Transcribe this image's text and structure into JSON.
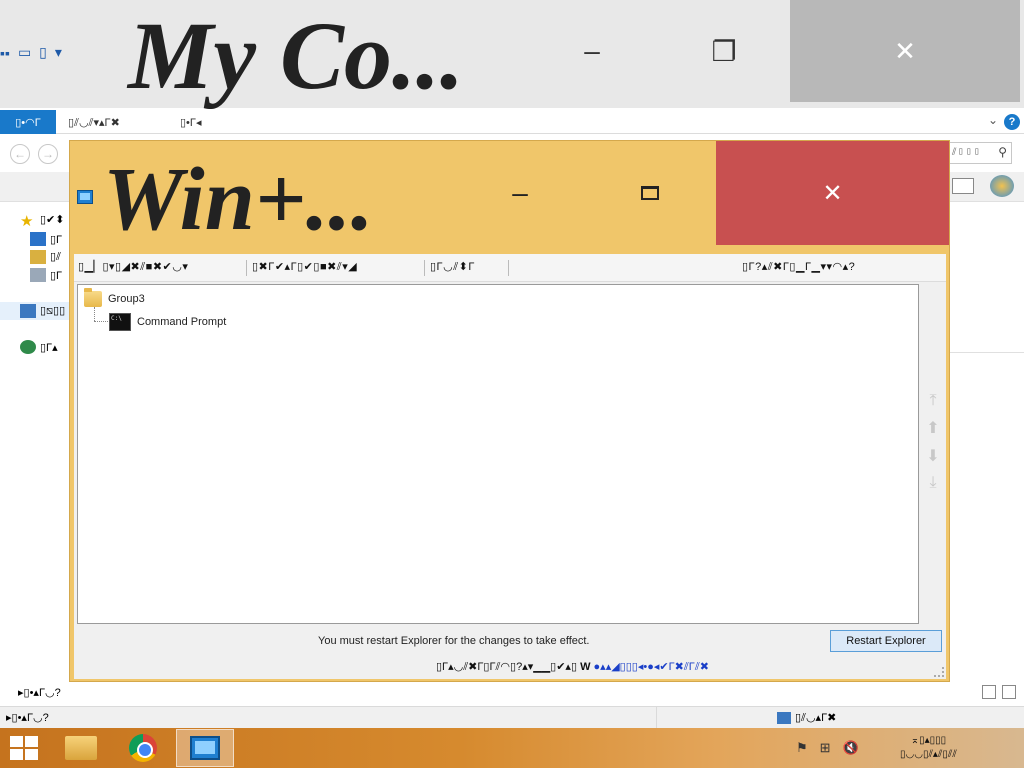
{
  "background_window": {
    "title": "My Co...",
    "ribbon": {
      "file_tab": "▯•◠Γ",
      "tabs": [
        "▯⫽◡⫽▾▴Γ✖",
        "▯•Γ◂"
      ]
    },
    "search_placeholder": "⫽▯▯▯",
    "nav_items": [
      "▯✔⬍",
      "▯Γ",
      "▯⫽",
      "▯Γ",
      "▯⧅▯▯",
      "▯Γ▴"
    ],
    "status_left": "▸▯•▴Γ◡?",
    "status2_left": "▸▯•▴Γ◡?",
    "status2_right": "▯⫽◡▴Γ✖"
  },
  "window": {
    "title": "Win+...",
    "toolbar": {
      "group1": "▯▁▏▯▾▯◢✖⫽■✖✔◡▾",
      "group2": "▯✖Γ✔▴Γ▯✔▯■✖⫽▾◢",
      "group3": "▯Γ◡⫽⬍Γ",
      "group4": "▯Γ?▴⫽✖Γ▯▁Γ▁▾▾◠▴?"
    },
    "tree": {
      "group": "Group3",
      "items": [
        "Command Prompt"
      ]
    },
    "notice": "You must restart Explorer for the changes to take effect.",
    "restart_button": "Restart Explorer",
    "footer_text": "▯Γ▴◡⫽✖Γ▯Γ⫽◠▯?▴▾▁▁▯✔▴▯",
    "footer_logo": "W",
    "footer_text2": "●▴▴◢▯▯▯◂•●◂✔Γ✖⫽Γ⫽✖"
  },
  "taskbar": {
    "clock_time": "⌅▯▴▯▯▯",
    "clock_date": "▯◡◡▯⫽▴⫽▯⫽⫽"
  },
  "colors": {
    "window_frame": "#f0c66a",
    "close_button": "#c85050",
    "accent": "#1979ca"
  }
}
